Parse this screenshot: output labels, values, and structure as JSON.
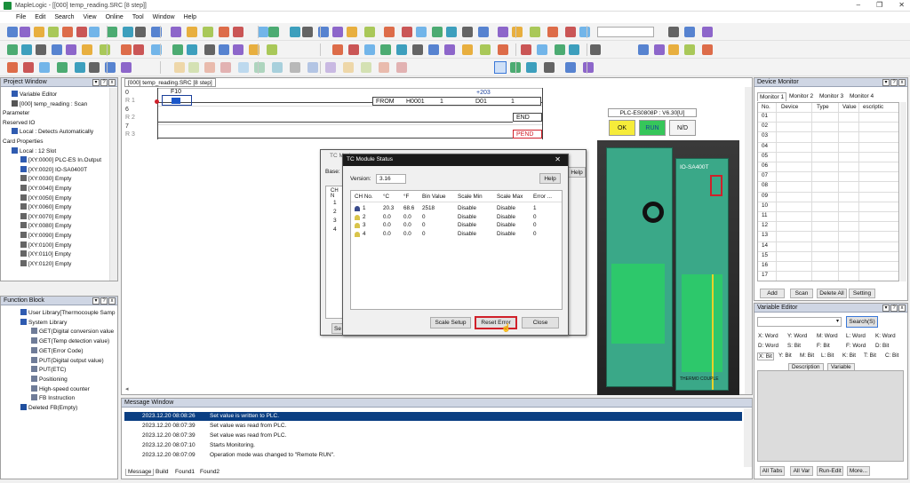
{
  "window": {
    "title": "MapleLogic - [[000] temp_reading.SRC [8 step]]",
    "buttons": [
      "–",
      "❐",
      "✕"
    ]
  },
  "menu": [
    "File",
    "Edit",
    "Search",
    "View",
    "Online",
    "Tool",
    "Window",
    "Help"
  ],
  "project_window": {
    "title": "Project Window",
    "items": [
      {
        "label": "Variable Editor",
        "indent": 1,
        "icon": "variable-icon"
      },
      {
        "label": "[000] temp_reading : Scan",
        "indent": 1,
        "icon": "program-icon"
      },
      {
        "label": "Parameter",
        "indent": 0,
        "icon": ""
      },
      {
        "label": "Reserved IO",
        "indent": 0,
        "icon": ""
      },
      {
        "label": "Local : Detects Automatically",
        "indent": 1,
        "icon": "io-icon"
      },
      {
        "label": "Card Properties",
        "indent": 0,
        "icon": ""
      },
      {
        "label": "Local : 12 Slot",
        "indent": 1,
        "icon": "slot-icon"
      },
      {
        "label": "[XY:0000] PLC-ES In.Output",
        "indent": 2,
        "icon": "cpu-icon"
      },
      {
        "label": "[XY:0020] IO-SA0400T",
        "indent": 2,
        "icon": "module-icon"
      },
      {
        "label": "[XY:0030] Empty",
        "indent": 2,
        "icon": "empty-slot-icon"
      },
      {
        "label": "[XY:0040] Empty",
        "indent": 2,
        "icon": "empty-slot-icon"
      },
      {
        "label": "[XY:0050] Empty",
        "indent": 2,
        "icon": "empty-slot-icon"
      },
      {
        "label": "[XY:0060] Empty",
        "indent": 2,
        "icon": "empty-slot-icon"
      },
      {
        "label": "[XY:0070] Empty",
        "indent": 2,
        "icon": "empty-slot-icon"
      },
      {
        "label": "[XY:0080] Empty",
        "indent": 2,
        "icon": "empty-slot-icon"
      },
      {
        "label": "[XY:0090] Empty",
        "indent": 2,
        "icon": "empty-slot-icon"
      },
      {
        "label": "[XY:0100] Empty",
        "indent": 2,
        "icon": "empty-slot-icon"
      },
      {
        "label": "[XY:0110] Empty",
        "indent": 2,
        "icon": "empty-slot-icon"
      },
      {
        "label": "[XY:0120] Empty",
        "indent": 2,
        "icon": "empty-slot-icon"
      }
    ]
  },
  "function_block": {
    "title": "Function Block",
    "items": [
      {
        "label": "User Library[Thermocouple Samp",
        "indent": 1
      },
      {
        "label": "System Library",
        "indent": 1
      },
      {
        "label": "GET(Digital conversion value",
        "indent": 2
      },
      {
        "label": "GET(Temp detection value)",
        "indent": 2
      },
      {
        "label": "GET(Error Code)",
        "indent": 2
      },
      {
        "label": "PUT(Digital output value)",
        "indent": 2
      },
      {
        "label": "PUT(ETC)",
        "indent": 2
      },
      {
        "label": "Positioning",
        "indent": 2
      },
      {
        "label": "High-speed counter",
        "indent": 2
      },
      {
        "label": "FB Instruction",
        "indent": 2
      },
      {
        "label": "Deleted FB(Empty)",
        "indent": 1
      }
    ]
  },
  "ladder": {
    "tab": "[000] temp_reading.SRC [8 step]",
    "rungs": [
      {
        "num": "0",
        "sub": "R 1"
      },
      {
        "num": "6",
        "sub": "R 2"
      },
      {
        "num": "7",
        "sub": "R 3"
      }
    ],
    "contact_label": "F10",
    "from_block": {
      "op": "FROM",
      "addr": "H0001",
      "n1": "1",
      "d": "D01",
      "n2": "1",
      "above": "+203"
    },
    "end_label": "END",
    "pend_label": "PEND"
  },
  "plc_panel": {
    "model": "PLC-ES0808P : V6.30[U]",
    "ok": "OK",
    "run": "RUN",
    "nd": "N/D",
    "module_label": "IO-SA400T",
    "bottom_label": "THERMO COUPLE"
  },
  "tc_module_bg": {
    "title": "TC Modu",
    "base_label": "Base:",
    "help": "Help",
    "ch_label": "CH N",
    "channels": [
      "1",
      "2",
      "3",
      "4"
    ],
    "s_btn": "Se"
  },
  "tc_status": {
    "title": "TC Module Status",
    "version_label": "Version:",
    "version_value": "3.16",
    "help": "Help",
    "columns": [
      "CH No.",
      "°C",
      "°F",
      "Bin Value",
      "Scale Min",
      "Scale Max",
      "Error ..."
    ],
    "rows": [
      [
        "1",
        "20.3",
        "68.6",
        "2518",
        "Disable",
        "Disable",
        "1"
      ],
      [
        "2",
        "0.0",
        "0.0",
        "0",
        "Disable",
        "Disable",
        "0"
      ],
      [
        "3",
        "0.0",
        "0.0",
        "0",
        "Disable",
        "Disable",
        "0"
      ],
      [
        "4",
        "0.0",
        "0.0",
        "0",
        "Disable",
        "Disable",
        "0"
      ]
    ],
    "scale_setup": "Scale Setup",
    "reset_error": "Reset Error",
    "close": "Close",
    "close_x": "✕"
  },
  "device_monitor": {
    "title": "Device Monitor",
    "tabs": [
      "Monitor 1",
      "Monitor 2",
      "Monitor 3",
      "Monitor 4"
    ],
    "columns": [
      "No.",
      "Device",
      "Type",
      "Value",
      "escriptic"
    ],
    "rows": [
      "01",
      "02",
      "03",
      "04",
      "05",
      "06",
      "07",
      "08",
      "09",
      "10",
      "11",
      "12",
      "13",
      "14",
      "15",
      "16",
      "17"
    ],
    "buttons": [
      "Add",
      "Scan",
      "Delete All",
      "Setting"
    ]
  },
  "variable_editor": {
    "title": "Variable Editor",
    "search": "Search(S)",
    "word_row1": [
      "X: Word",
      "Y: Word",
      "M: Word",
      "L: Word",
      "K: Word"
    ],
    "word_row2": [
      "D: Word",
      "S: Bit",
      "F: Bit",
      "F: Word",
      "D: Bit"
    ],
    "bit_row": [
      "X: Bit",
      "Y: Bit",
      "M: Bit",
      "L: Bit",
      "K: Bit",
      "T: Bit",
      "C: Bit"
    ],
    "sub_tabs": [
      "Description",
      "Variable"
    ],
    "bottom_buttons": [
      "All Tabs",
      "All Var",
      "Run-Edit",
      "More..."
    ]
  },
  "message_window": {
    "title": "Message Window",
    "rows": [
      {
        "time": "2023.12.20 08:08:26",
        "text": "Set value is written to PLC."
      },
      {
        "time": "2023.12.20 08:07:39",
        "text": "Set value was read from PLC."
      },
      {
        "time": "2023.12.20 08:07:39",
        "text": "Set value was read from PLC."
      },
      {
        "time": "2023.12.20 08:07:10",
        "text": "Starts Monitoring."
      },
      {
        "time": "2023.12.20 08:07:09",
        "text": "Operation mode was changed to \"Remote RUN\"."
      }
    ],
    "tabs": [
      "Message",
      "Build",
      "Found1",
      "Found2"
    ]
  },
  "colors": {
    "accent_red": "#d0202a",
    "selection": "#0a3e82",
    "ok_yellow": "#f6ec3a",
    "run_green": "#36c65a"
  }
}
